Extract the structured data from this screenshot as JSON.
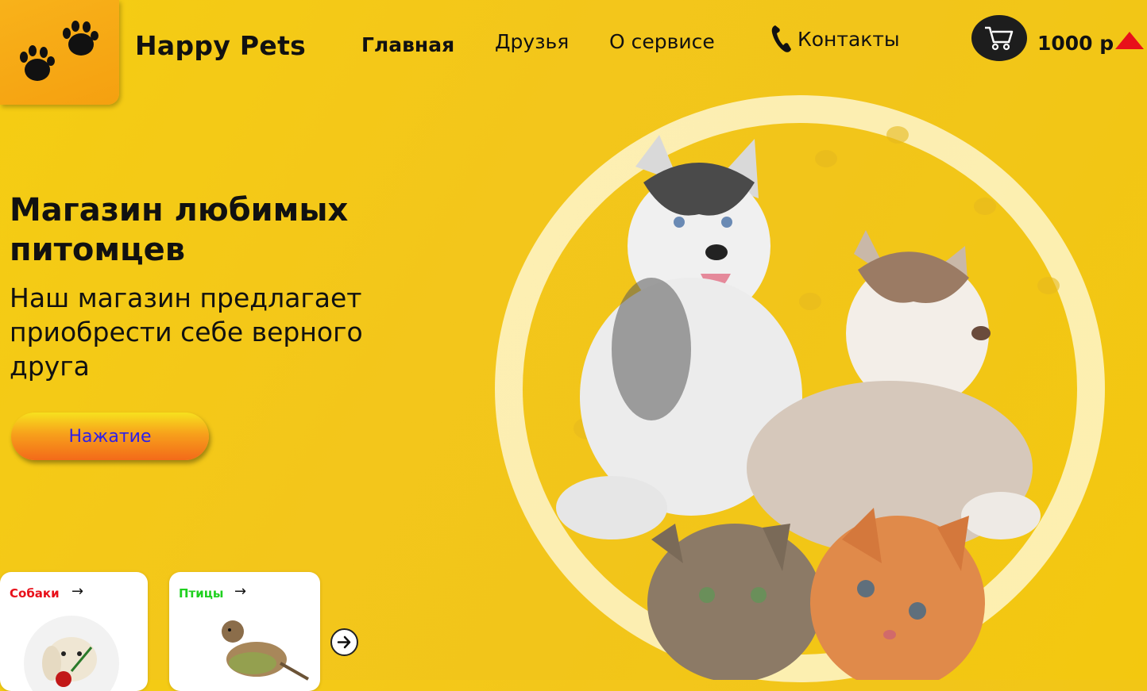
{
  "brand": {
    "name": "Happy Pets",
    "logo_icon": "paw-prints-icon"
  },
  "nav": {
    "items": [
      {
        "label": "Главная",
        "active": true
      },
      {
        "label": "Друзья"
      },
      {
        "label": "О сервисе"
      },
      {
        "label": "Контакты",
        "icon": "phone-icon"
      }
    ]
  },
  "cart": {
    "icon": "cart-icon",
    "price": "1000 р"
  },
  "hero": {
    "title": "Магазин любимых питомцев",
    "subtitle": "Наш магазин предлагает приобрести себе верного друга",
    "cta_label": "Нажатие"
  },
  "categories": [
    {
      "label": "Собаки",
      "color": "#e8101a",
      "arrow": "→"
    },
    {
      "label": "Птицы",
      "color": "#1fd01f",
      "arrow": "→"
    }
  ],
  "colors": {
    "background": "#f3c81a",
    "accent": "#e8101a",
    "cta_text": "#2d1fe8"
  }
}
